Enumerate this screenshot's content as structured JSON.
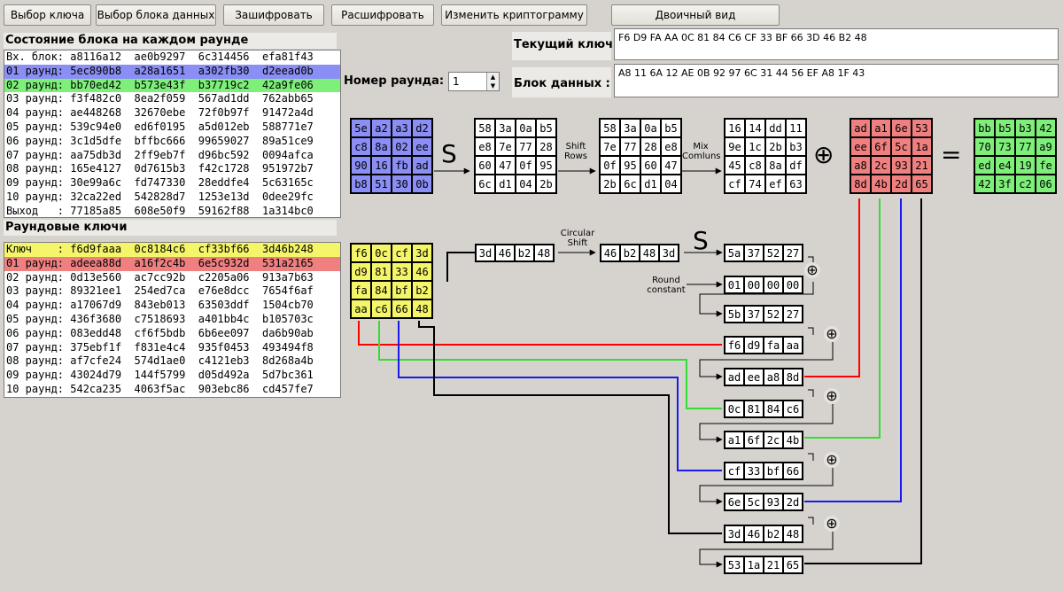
{
  "toolbar": {
    "select_key": "Выбор ключа",
    "select_block": "Выбор блока данных",
    "encrypt": "Зашифровать",
    "decrypt": "Расшифровать",
    "change_cryptogram": "Изменить криптограмму",
    "binary_view": "Двоичный вид"
  },
  "state_panel": {
    "title": "Состояние блока на каждом раунде",
    "rows": [
      "Вх. блок: a8116a12  ae0b9297  6c314456  efa81f43",
      "01 раунд: 5ec890b8  a28a1651  a302fb30  d2eead0b",
      "02 раунд: bb70ed42  b573e43f  b37719c2  42a9fe06",
      "03 раунд: f3f482c0  8ea2f059  567ad1dd  762abb65",
      "04 раунд: ae448268  32670ebe  72f0b97f  91472a4d",
      "05 раунд: 539c94e0  ed6f0195  a5d012eb  588771e7",
      "06 раунд: 3c1d5dfe  bffbc666  99659027  89a51ce9",
      "07 раунд: aa75db3d  2ff9eb7f  d96bc592  0094afca",
      "08 раунд: 165e4127  0d7615b3  f42c1728  951972b7",
      "09 раунд: 30e99a6c  fd747330  28eddfe4  5c63165c",
      "10 раунд: 32ca22ed  542828d7  1253e13d  0dee29fc",
      "Выход   : 77185a85  608e50f9  59162f88  1a314bc0"
    ]
  },
  "keys_panel": {
    "title": "Раундовые ключи",
    "rows": [
      "Ключ    : f6d9faaa  0c8184c6  cf33bf66  3d46b248",
      "01 раунд: adeea88d  a16f2c4b  6e5c932d  531a2165",
      "02 раунд: 0d13e560  ac7cc92b  c2205a06  913a7b63",
      "03 раунд: 89321ee1  254ed7ca  e76e8dcc  7654f6af",
      "04 раунд: a17067d9  843eb013  63503ddf  1504cb70",
      "05 раунд: 436f3680  c7518693  a401bb4c  b105703c",
      "06 раунд: 083edd48  cf6f5bdb  6b6ee097  da6b90ab",
      "07 раунд: 375ebf1f  f831e4c4  935f0453  493494f8",
      "08 раунд: af7cfe24  574d1ae0  c4121eb3  8d268a4b",
      "09 раунд: 43024d79  144f5799  d05d492a  5d7bc361",
      "10 раунд: 542ca235  4063f5ac  903ebc86  cd457fe7"
    ]
  },
  "round": {
    "label": "Номер раунда:",
    "value": "1"
  },
  "current_key": {
    "label": "Текущий ключ:",
    "value": "F6 D9 FA AA 0C 81 84 C6 CF 33 BF 66 3D 46 B2 48"
  },
  "data_block": {
    "label": "Блок данных :",
    "value": "A8 11 6A 12 AE 0B 92 97 6C 31 44 56 EF A8 1F 43"
  },
  "colors": {
    "blue": "#8a8ef5",
    "green": "#7ef07a",
    "yellow": "#f5f56a",
    "red": "#f08080",
    "line_red": "#ff0000",
    "line_green": "#33dd33",
    "line_blue": "#1a1aee"
  },
  "diagram": {
    "labels": {
      "s": "S",
      "shift_rows": "Shift\nRows",
      "mix_columns": "Mix\nComluns",
      "circular_shift": "Circular\nShift",
      "round_constant": "Round\nconstant",
      "xor": "⊕",
      "equals": "="
    },
    "state_in": [
      "5e",
      "a2",
      "a3",
      "d2",
      "c8",
      "8a",
      "02",
      "ee",
      "90",
      "16",
      "fb",
      "ad",
      "b8",
      "51",
      "30",
      "0b"
    ],
    "after_sub": [
      "58",
      "3a",
      "0a",
      "b5",
      "e8",
      "7e",
      "77",
      "28",
      "60",
      "47",
      "0f",
      "95",
      "6c",
      "d1",
      "04",
      "2b"
    ],
    "after_shift": [
      "58",
      "3a",
      "0a",
      "b5",
      "7e",
      "77",
      "28",
      "e8",
      "0f",
      "95",
      "60",
      "47",
      "2b",
      "6c",
      "d1",
      "04"
    ],
    "after_mix": [
      "16",
      "14",
      "dd",
      "11",
      "9e",
      "1c",
      "2b",
      "b3",
      "45",
      "c8",
      "8a",
      "df",
      "cf",
      "74",
      "ef",
      "63"
    ],
    "round_key": [
      "ad",
      "a1",
      "6e",
      "53",
      "ee",
      "6f",
      "5c",
      "1a",
      "a8",
      "2c",
      "93",
      "21",
      "8d",
      "4b",
      "2d",
      "65"
    ],
    "result": [
      "bb",
      "b5",
      "b3",
      "42",
      "70",
      "73",
      "77",
      "a9",
      "ed",
      "e4",
      "19",
      "fe",
      "42",
      "3f",
      "c2",
      "06"
    ],
    "prev_key": [
      "f6",
      "0c",
      "cf",
      "3d",
      "d9",
      "81",
      "33",
      "46",
      "fa",
      "84",
      "bf",
      "b2",
      "aa",
      "c6",
      "66",
      "48"
    ],
    "last_word": [
      "3d",
      "46",
      "b2",
      "48"
    ],
    "shifted_word": [
      "46",
      "b2",
      "48",
      "3d"
    ],
    "sub_word": [
      "5a",
      "37",
      "52",
      "27"
    ],
    "rcon": [
      "01",
      "00",
      "00",
      "00"
    ],
    "temp": [
      "5b",
      "37",
      "52",
      "27"
    ],
    "w0": [
      "f6",
      "d9",
      "fa",
      "aa"
    ],
    "w0n": [
      "ad",
      "ee",
      "a8",
      "8d"
    ],
    "w1": [
      "0c",
      "81",
      "84",
      "c6"
    ],
    "w1n": [
      "a1",
      "6f",
      "2c",
      "4b"
    ],
    "w2": [
      "cf",
      "33",
      "bf",
      "66"
    ],
    "w2n": [
      "6e",
      "5c",
      "93",
      "2d"
    ],
    "w3": [
      "3d",
      "46",
      "b2",
      "48"
    ],
    "w3n": [
      "53",
      "1a",
      "21",
      "65"
    ]
  }
}
